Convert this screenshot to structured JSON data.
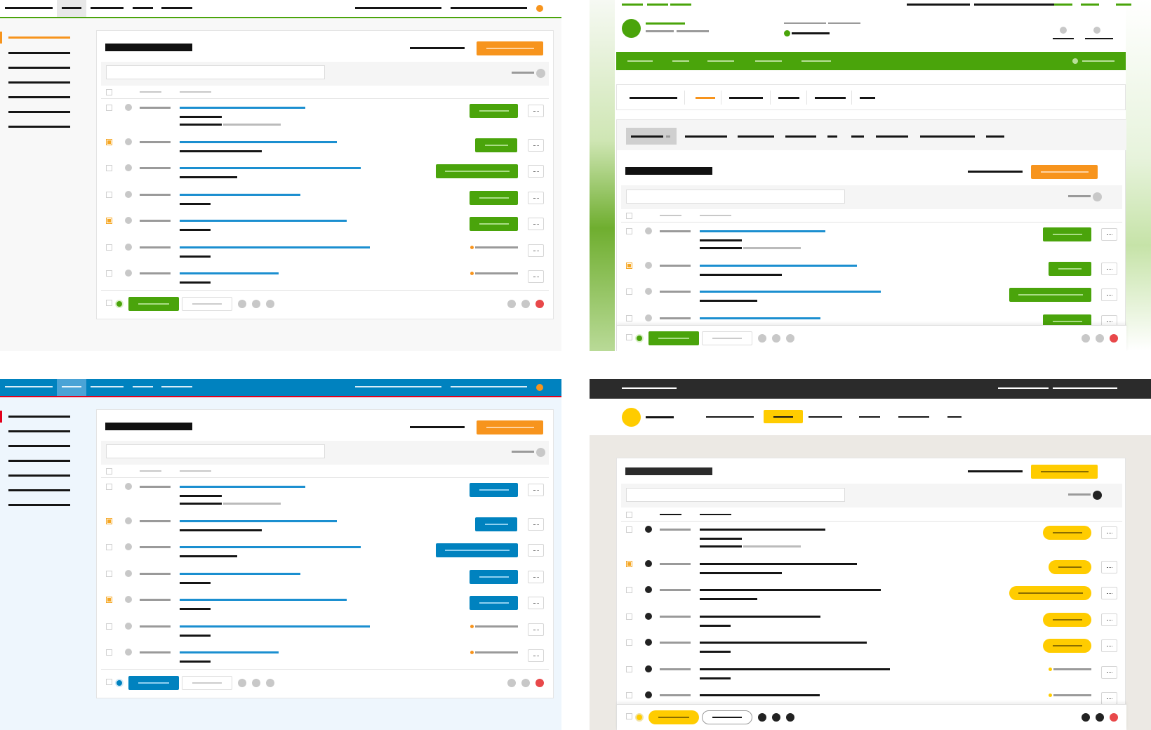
{
  "variants": [
    {
      "id": "orange",
      "accent": "#4aa40b",
      "link": "#1b8fd0",
      "cta": "#f7941d",
      "selected": "#f7941d"
    },
    {
      "id": "green",
      "accent": "#4aa40b",
      "link": "#1b8fd0",
      "cta": "#f7941d",
      "selected": "#f7941d"
    },
    {
      "id": "blue",
      "accent": "#0082bf",
      "link": "#1b8fd0",
      "cta": "#f7941d",
      "selected": "#e3001b"
    },
    {
      "id": "dark",
      "accent": "#ffcc00",
      "link": "#151515",
      "cta": "#ffcc00",
      "selected": "#ffcc00"
    }
  ],
  "icons": [
    "more-icon",
    "status-dot-icon",
    "checkbox-icon",
    "search-icon",
    "avatar-icon"
  ],
  "rows": [
    {
      "selected": false,
      "status": "button",
      "button_size": "medium",
      "lines": 3
    },
    {
      "selected": true,
      "status": "button",
      "button_size": "small",
      "lines": 2
    },
    {
      "selected": false,
      "status": "button",
      "button_size": "large",
      "lines": 2
    },
    {
      "selected": false,
      "status": "button",
      "button_size": "medium",
      "lines": 2
    },
    {
      "selected": true,
      "status": "button",
      "button_size": "medium",
      "lines": 2
    },
    {
      "selected": false,
      "status": "pending",
      "lines": 2
    },
    {
      "selected": false,
      "status": "pending",
      "lines": 2
    }
  ]
}
